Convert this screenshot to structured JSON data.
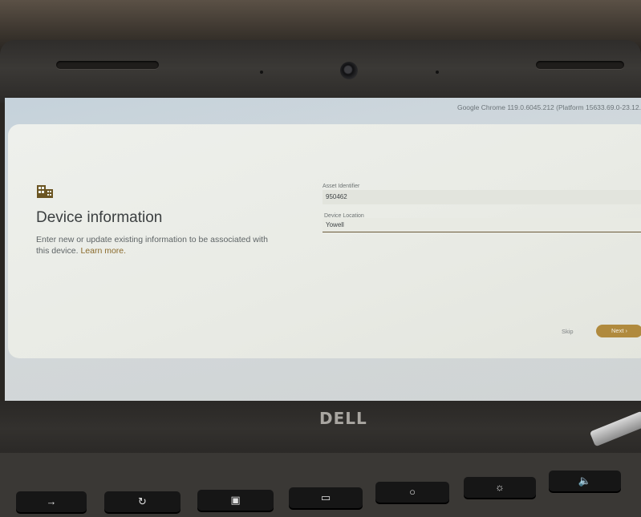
{
  "system": {
    "version_text": "Google Chrome 119.0.6045.212 (Platform 15633.69.0-23.12."
  },
  "page": {
    "icon": "building-icon",
    "title": "Device information",
    "description": "Enter new or update existing information to be associated with this device.",
    "learn_more": "Learn more."
  },
  "form": {
    "asset": {
      "label": "Asset Identifier",
      "value": "950462"
    },
    "location": {
      "label": "Device Location",
      "value": "Yowell"
    }
  },
  "actions": {
    "skip": "Skip",
    "next": "Next"
  },
  "hardware": {
    "brand": "DELL"
  },
  "colors": {
    "accent": "#b08a3e",
    "link": "#8a6a2c"
  }
}
